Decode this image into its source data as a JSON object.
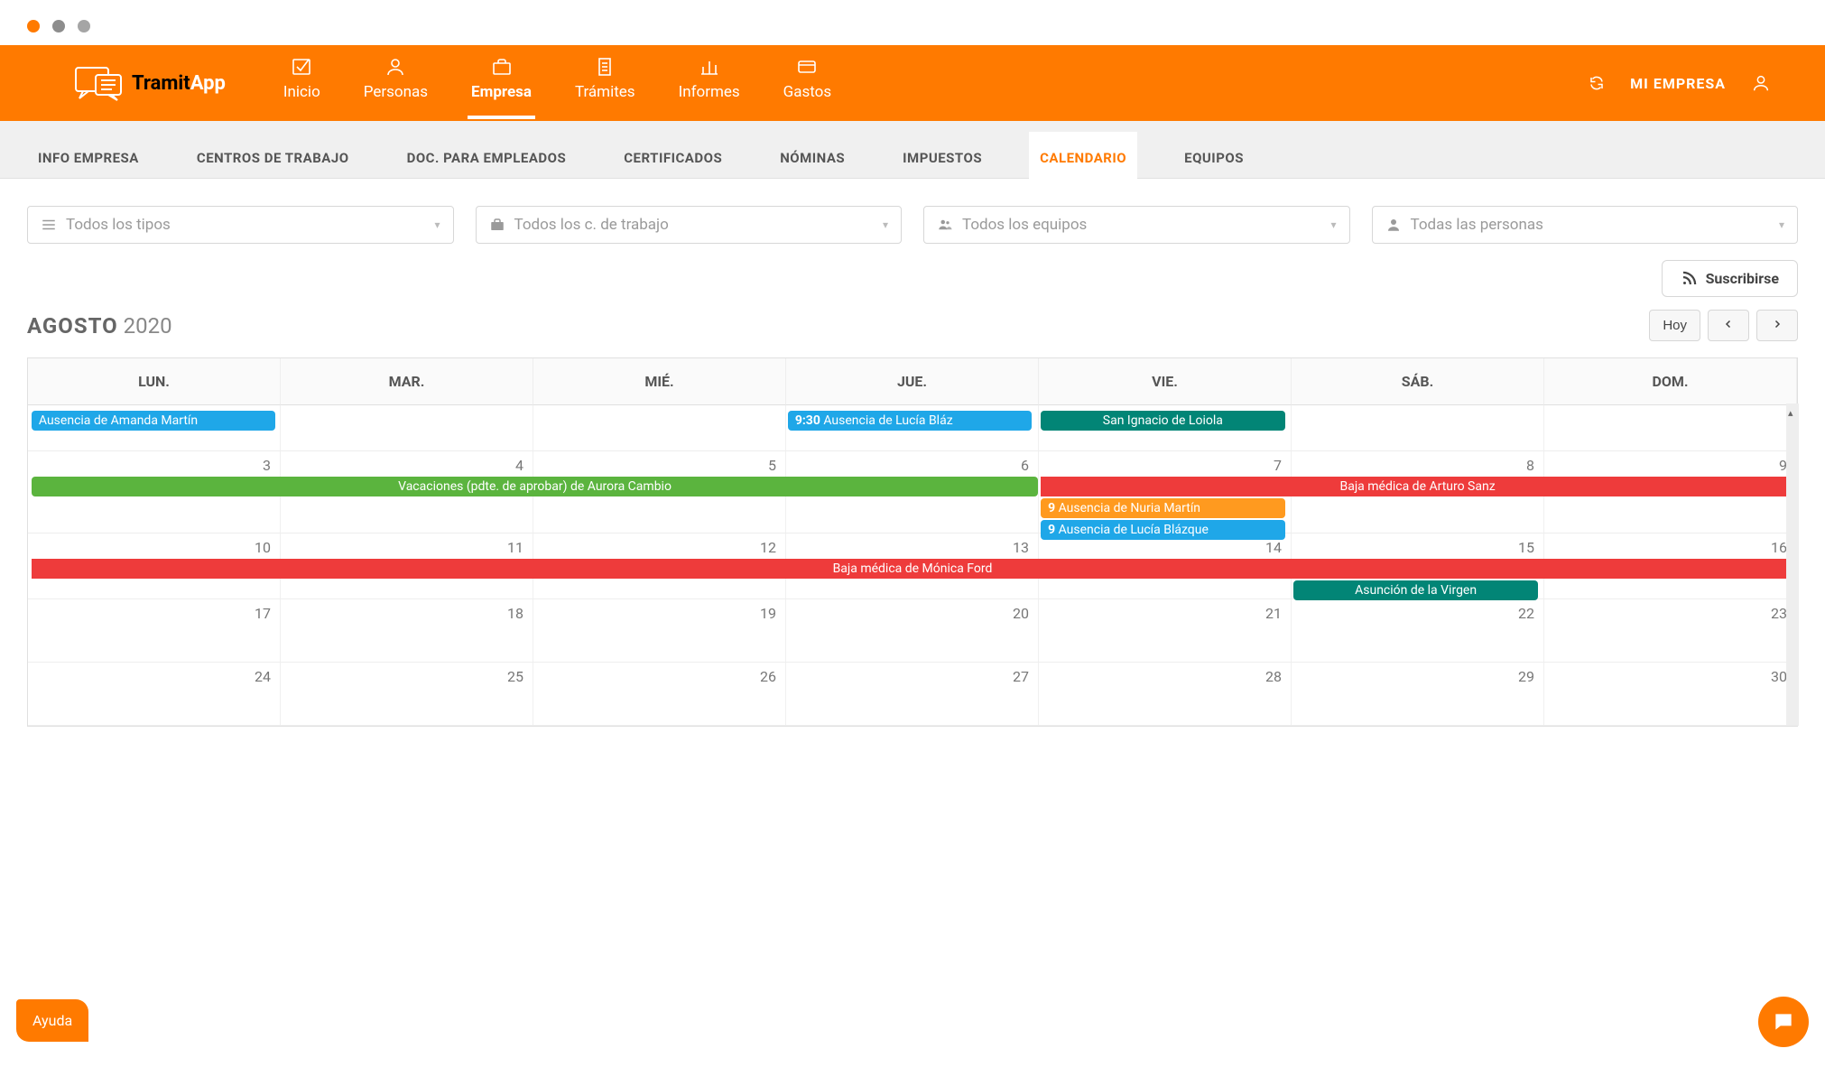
{
  "app": {
    "name_dark": "Tramit",
    "name_light": "App"
  },
  "nav": [
    {
      "id": "inicio",
      "label": "Inicio"
    },
    {
      "id": "personas",
      "label": "Personas"
    },
    {
      "id": "empresa",
      "label": "Empresa",
      "active": true
    },
    {
      "id": "tramites",
      "label": "Trámites"
    },
    {
      "id": "informes",
      "label": "Informes"
    },
    {
      "id": "gastos",
      "label": "Gastos"
    }
  ],
  "top_right": {
    "company": "MI EMPRESA"
  },
  "subnav": [
    {
      "label": "INFO EMPRESA"
    },
    {
      "label": "CENTROS DE TRABAJO"
    },
    {
      "label": "DOC. PARA EMPLEADOS"
    },
    {
      "label": "CERTIFICADOS"
    },
    {
      "label": "NÓMINAS"
    },
    {
      "label": "IMPUESTOS"
    },
    {
      "label": "CALENDARIO",
      "active": true
    },
    {
      "label": "EQUIPOS"
    }
  ],
  "filters": {
    "types": "Todos los tipos",
    "centers": "Todos los c. de trabajo",
    "teams": "Todos los equipos",
    "people": "Todas las personas"
  },
  "subscribe": "Suscribirse",
  "calendar": {
    "month": "AGOSTO",
    "year": "2020",
    "today": "Hoy",
    "weekdays": [
      "LUN.",
      "MAR.",
      "MIÉ.",
      "JUE.",
      "VIE.",
      "SÁB.",
      "DOM."
    ],
    "weeks": [
      [
        "",
        "",
        "",
        "",
        "",
        "",
        ""
      ],
      [
        "3",
        "4",
        "5",
        "6",
        "7",
        "8",
        "9"
      ],
      [
        "10",
        "11",
        "12",
        "13",
        "14",
        "15",
        "16"
      ],
      [
        "17",
        "18",
        "19",
        "20",
        "21",
        "22",
        "23"
      ],
      [
        "24",
        "25",
        "26",
        "27",
        "28",
        "29",
        "30"
      ]
    ],
    "events": {
      "w0_amanda": "Ausencia de Amanda Martín",
      "w0_lucia_time": "9:30",
      "w0_lucia": "Ausencia de Lucía Bláz",
      "w0_ignacio": "San Ignacio de Loiola",
      "w1_aurora": "Vacaciones (pdte. de aprobar) de Aurora Cambio",
      "w1_arturo": "Baja médica de Arturo Sanz",
      "w1_nuria_time": "9",
      "w1_nuria": "Ausencia de Nuria Martín",
      "w1_lucia_time": "9",
      "w1_lucia": "Ausencia de Lucía Blázque",
      "w2_monica": "Baja médica de Mónica Ford",
      "w2_asuncion": "Asunción de la Virgen"
    }
  },
  "help": "Ayuda"
}
